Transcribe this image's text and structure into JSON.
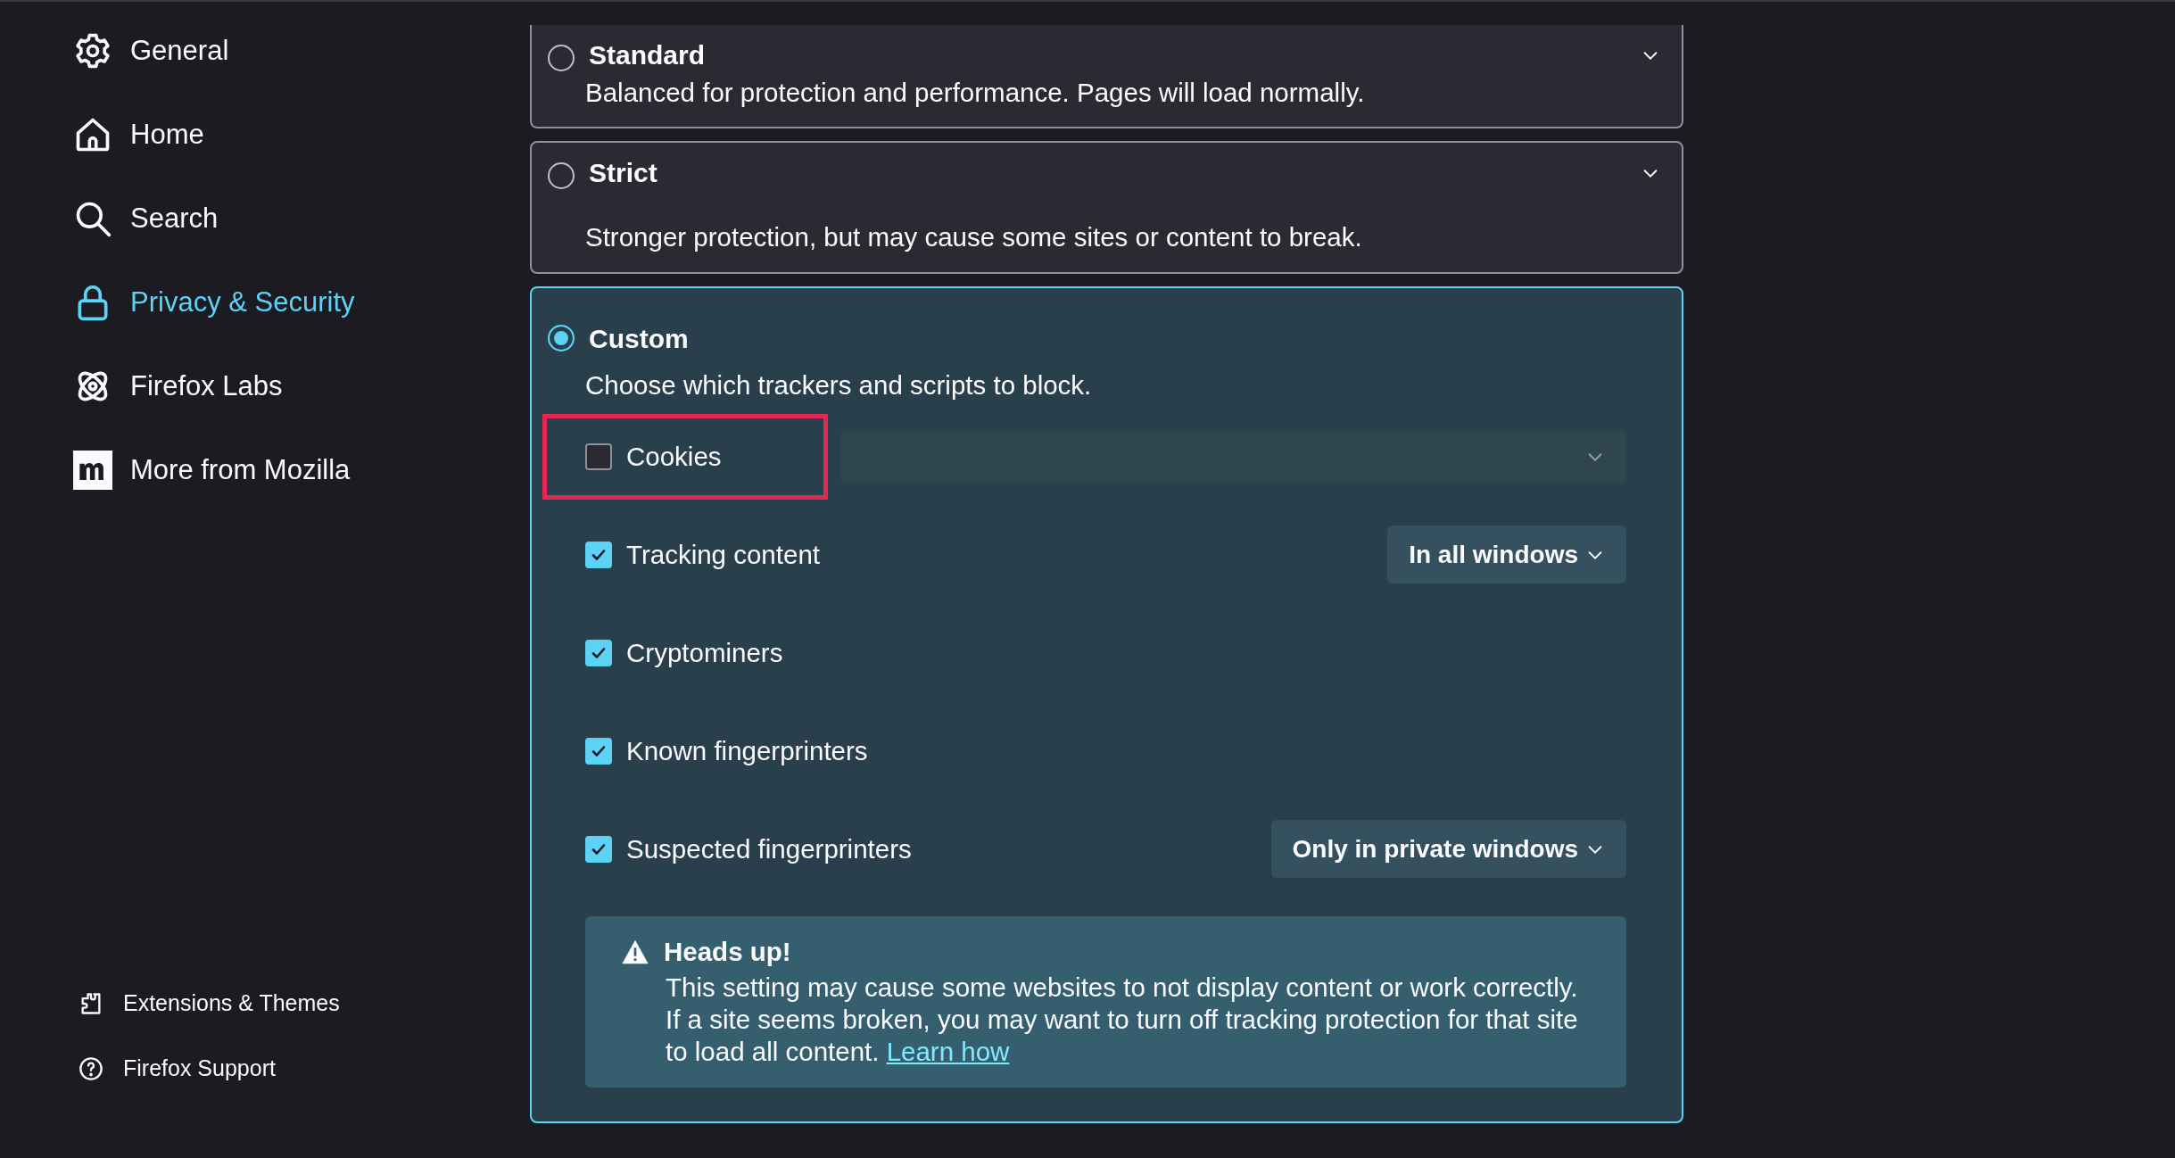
{
  "sidebar": {
    "items": [
      {
        "label": "General",
        "selected": false
      },
      {
        "label": "Home",
        "selected": false
      },
      {
        "label": "Search",
        "selected": false
      },
      {
        "label": "Privacy & Security",
        "selected": true
      },
      {
        "label": "Firefox Labs",
        "selected": false
      },
      {
        "label": "More from Mozilla",
        "selected": false
      }
    ],
    "footer_items": [
      {
        "label": "Extensions & Themes"
      },
      {
        "label": "Firefox Support"
      }
    ]
  },
  "protection_levels": [
    {
      "title": "Standard",
      "description": "Balanced for protection and performance. Pages will load normally.",
      "selected": false,
      "expanded": false
    },
    {
      "title": "Strict",
      "description": "Stronger protection, but may cause some sites or content to break.",
      "selected": false,
      "expanded": false
    },
    {
      "title": "Custom",
      "description": "Choose which trackers and scripts to block.",
      "selected": true,
      "expanded": true,
      "options": [
        {
          "label": "Cookies",
          "checked": false,
          "highlighted": true,
          "dropdown": {
            "disabled": true
          }
        },
        {
          "label": "Tracking content",
          "checked": true,
          "dropdown": {
            "value": "In all windows"
          }
        },
        {
          "label": "Cryptominers",
          "checked": true
        },
        {
          "label": "Known fingerprinters",
          "checked": true
        },
        {
          "label": "Suspected fingerprinters",
          "checked": true,
          "dropdown": {
            "value": "Only in private windows"
          }
        }
      ],
      "alert": {
        "title": "Heads up!",
        "text": "This setting may cause some websites to not display content or work correctly. If a site seems broken, you may want to turn off tracking protection for that site to load all content.",
        "link": "Learn how"
      }
    }
  ]
}
